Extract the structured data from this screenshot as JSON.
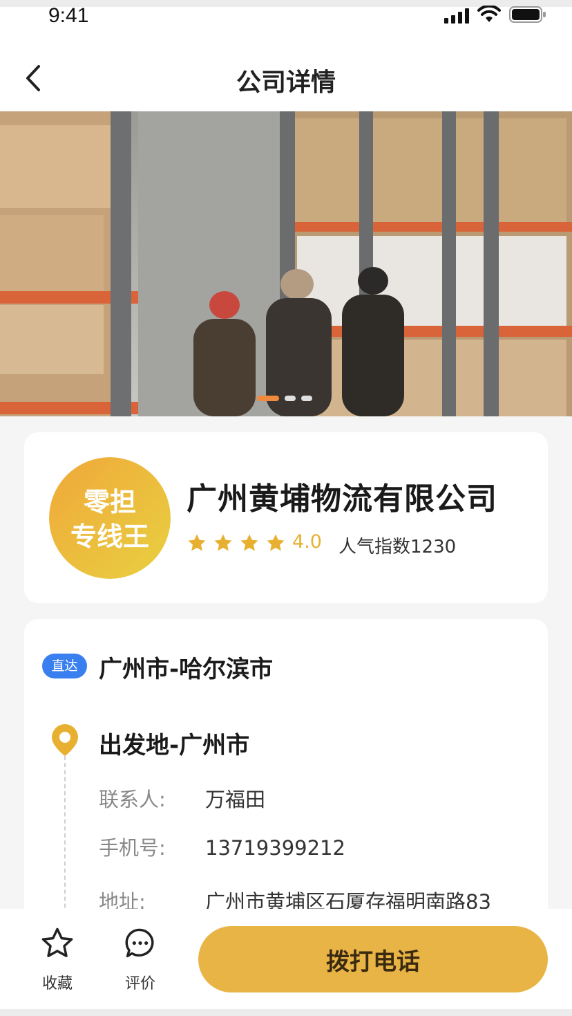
{
  "status_bar": {
    "time": "9:41"
  },
  "nav": {
    "title": "公司详情"
  },
  "banner": {
    "slide_count": 3,
    "active_slide": 1
  },
  "company": {
    "logo_line1": "零担",
    "logo_line2": "专线王",
    "name": "广州黄埔物流有限公司",
    "stars": 4,
    "rating": "4.0",
    "popularity": "人气指数1230"
  },
  "route_card": {
    "tag": "直达",
    "route": "广州市-哈尔滨市",
    "departure": "出发地-广州市",
    "fields": [
      {
        "label": "联系人:",
        "value": "万福田"
      },
      {
        "label": "手机号:",
        "value": "13719399212"
      },
      {
        "label": "地址:",
        "value": "广州市黄埔区石厦存福明南路83"
      }
    ]
  },
  "bottom_bar": {
    "favorite_label": "收藏",
    "review_label": "评价",
    "call_label": "拨打电话"
  },
  "colors": {
    "accent": "#e9b446",
    "tag_blue": "#3a7ff0",
    "star": "#e8b030",
    "dot_active": "#f08a3c"
  }
}
